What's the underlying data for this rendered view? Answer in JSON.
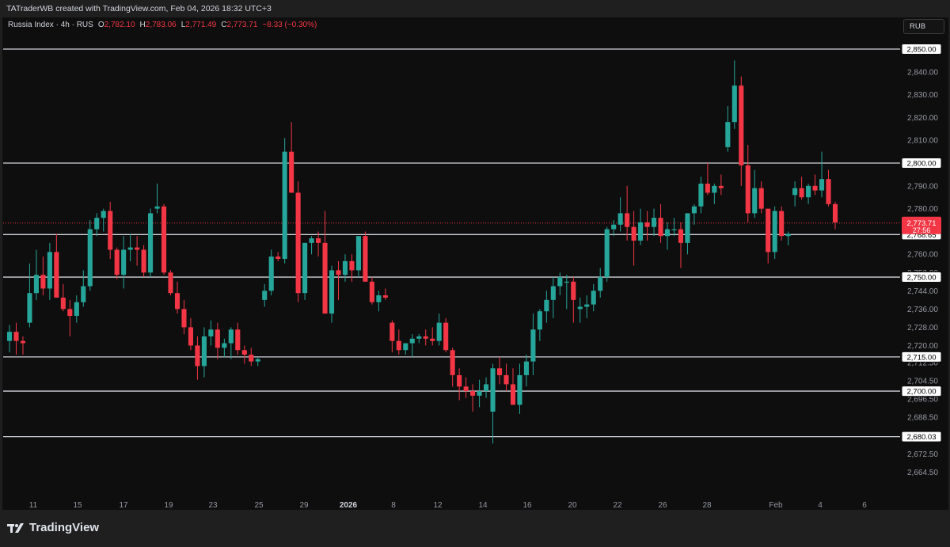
{
  "credit": "TATraderWB created with TradingView.com, Feb 04, 2026 18:32 UTC+3",
  "legend": {
    "symbol": "Russia Index · 4h · RUS",
    "o_label": "O",
    "o_value": "2,782.10",
    "h_label": "H",
    "h_value": "2,783.06",
    "l_label": "L",
    "l_value": "2,771.49",
    "c_label": "C",
    "c_value": "2,773.71",
    "change": "−8.33 (−0.30%)"
  },
  "currency": "RUB",
  "brand": "TradingView",
  "colors": {
    "up": "#26a69a",
    "down": "#f23645",
    "grid_line": "#d1d4dc",
    "background": "#0e0e0e"
  },
  "chart_data": {
    "type": "candlestick",
    "timeframe": "4h",
    "y_axis": {
      "ticks": [
        "2,840.00",
        "2,830.00",
        "2,820.00",
        "2,810.00",
        "2,790.00",
        "2,780.00",
        "2,760.00",
        "2,752.00",
        "2,744.00",
        "2,736.00",
        "2,728.00",
        "2,720.00",
        "2,712.50",
        "2,704.50",
        "2,696.50",
        "2,688.50",
        "2,672.50",
        "2,664.50"
      ],
      "tick_values": [
        2840,
        2830,
        2820,
        2810,
        2790,
        2780,
        2760,
        2752,
        2744,
        2736,
        2728,
        2720,
        2712.5,
        2704.5,
        2696.5,
        2688.5,
        2672.5,
        2664.5
      ]
    },
    "x_axis": {
      "labels": [
        "11",
        "15",
        "17",
        "19",
        "23",
        "25",
        "29",
        "2026",
        "8",
        "12",
        "14",
        "16",
        "20",
        "22",
        "26",
        "28",
        "Feb",
        "4",
        "6"
      ]
    },
    "horizontal_levels": [
      {
        "label": "2,850.00",
        "value": 2850
      },
      {
        "label": "2,800.00",
        "value": 2800
      },
      {
        "label": "2,768.65",
        "value": 2768.65
      },
      {
        "label": "2,750.00",
        "value": 2750
      },
      {
        "label": "2,715.00",
        "value": 2715
      },
      {
        "label": "2,700.00",
        "value": 2700
      },
      {
        "label": "2,680.03",
        "value": 2680.03
      }
    ],
    "last_price": {
      "label": "2,773.71",
      "countdown": "27:56",
      "value": 2773.71
    },
    "candles": [
      [
        2722,
        2729,
        2717,
        2726
      ],
      [
        2726,
        2730,
        2716,
        2722
      ],
      [
        2722,
        2724,
        2716,
        2721
      ],
      [
        2730,
        2756,
        2728,
        2743
      ],
      [
        2743,
        2762,
        2740,
        2751
      ],
      [
        2751,
        2759,
        2742,
        2745
      ],
      [
        2745,
        2765,
        2740,
        2761
      ],
      [
        2761,
        2769,
        2742,
        2741
      ],
      [
        2741,
        2747,
        2735,
        2736
      ],
      [
        2736,
        2740,
        2724,
        2733
      ],
      [
        2733,
        2742,
        2730,
        2739
      ],
      [
        2739,
        2753,
        2737,
        2746
      ],
      [
        2746,
        2775,
        2744,
        2771
      ],
      [
        2771,
        2778,
        2768,
        2776
      ],
      [
        2776,
        2780,
        2770,
        2779
      ],
      [
        2779,
        2783,
        2758,
        2762
      ],
      [
        2762,
        2763,
        2749,
        2751
      ],
      [
        2751,
        2768,
        2745,
        2762
      ],
      [
        2762,
        2769,
        2757,
        2763
      ],
      [
        2763,
        2768,
        2755,
        2762
      ],
      [
        2762,
        2764,
        2750,
        2752
      ],
      [
        2752,
        2780,
        2750,
        2778
      ],
      [
        2780,
        2791,
        2778,
        2781
      ],
      [
        2781,
        2782,
        2751,
        2752
      ],
      [
        2752,
        2753,
        2742,
        2743
      ],
      [
        2743,
        2748,
        2734,
        2736
      ],
      [
        2736,
        2740,
        2725,
        2728
      ],
      [
        2728,
        2732,
        2718,
        2720
      ],
      [
        2720,
        2724,
        2705,
        2711
      ],
      [
        2711,
        2728,
        2706,
        2724
      ],
      [
        2724,
        2731,
        2720,
        2727
      ],
      [
        2727,
        2730,
        2714,
        2719
      ],
      [
        2719,
        2723,
        2715,
        2721
      ],
      [
        2721,
        2728,
        2714,
        2727
      ],
      [
        2727,
        2730,
        2716,
        2718
      ],
      [
        2718,
        2720,
        2712,
        2716
      ],
      [
        2716,
        2719,
        2711,
        2713
      ],
      [
        2713,
        2715,
        2711,
        2714
      ],
      [
        2740,
        2747,
        2737,
        2744
      ],
      [
        2744,
        2762,
        2742,
        2759
      ],
      [
        2759,
        2761,
        2757,
        2758
      ],
      [
        2758,
        2811,
        2756,
        2805
      ],
      [
        2805,
        2818,
        2788,
        2787
      ],
      [
        2787,
        2792,
        2739,
        2743
      ],
      [
        2743,
        2765,
        2740,
        2765
      ],
      [
        2765,
        2768,
        2760,
        2767
      ],
      [
        2767,
        2770,
        2759,
        2765
      ],
      [
        2765,
        2779,
        2735,
        2734
      ],
      [
        2734,
        2755,
        2730,
        2753
      ],
      [
        2753,
        2757,
        2740,
        2751
      ],
      [
        2751,
        2760,
        2748,
        2757
      ],
      [
        2757,
        2760,
        2748,
        2753
      ],
      [
        2753,
        2768,
        2750,
        2768
      ],
      [
        2768,
        2770,
        2748,
        2748
      ],
      [
        2748,
        2750,
        2738,
        2739
      ],
      [
        2739,
        2744,
        2735,
        2742
      ],
      [
        2742,
        2745,
        2740,
        2741
      ],
      [
        2730,
        2731,
        2717,
        2722
      ],
      [
        2722,
        2727,
        2716,
        2718
      ],
      [
        2718,
        2721,
        2716,
        2721
      ],
      [
        2721,
        2725,
        2715,
        2723
      ],
      [
        2723,
        2725,
        2721,
        2724
      ],
      [
        2724,
        2727,
        2720,
        2723
      ],
      [
        2723,
        2728,
        2720,
        2722
      ],
      [
        2722,
        2734,
        2720,
        2730
      ],
      [
        2730,
        2732,
        2717,
        2718
      ],
      [
        2718,
        2719,
        2702,
        2707
      ],
      [
        2707,
        2710,
        2696,
        2702
      ],
      [
        2702,
        2706,
        2697,
        2700
      ],
      [
        2700,
        2703,
        2691,
        2698
      ],
      [
        2698,
        2705,
        2693,
        2700
      ],
      [
        2700,
        2706,
        2697,
        2703
      ],
      [
        2691,
        2712,
        2677,
        2710
      ],
      [
        2710,
        2715,
        2703,
        2707
      ],
      [
        2707,
        2712,
        2700,
        2703
      ],
      [
        2703,
        2710,
        2694,
        2694
      ],
      [
        2694,
        2712,
        2690,
        2707
      ],
      [
        2707,
        2716,
        2702,
        2713
      ],
      [
        2713,
        2734,
        2707,
        2727
      ],
      [
        2727,
        2736,
        2722,
        2735
      ],
      [
        2735,
        2744,
        2730,
        2740
      ],
      [
        2740,
        2750,
        2732,
        2746
      ],
      [
        2746,
        2752,
        2742,
        2750
      ],
      [
        2748,
        2751,
        2736,
        2748
      ],
      [
        2748,
        2750,
        2730,
        2740
      ],
      [
        2736,
        2741,
        2730,
        2737
      ],
      [
        2737,
        2742,
        2732,
        2738
      ],
      [
        2738,
        2747,
        2735,
        2744
      ],
      [
        2744,
        2754,
        2741,
        2750
      ],
      [
        2750,
        2772,
        2748,
        2771
      ],
      [
        2771,
        2775,
        2768,
        2773
      ],
      [
        2773,
        2785,
        2770,
        2778
      ],
      [
        2778,
        2790,
        2766,
        2772
      ],
      [
        2772,
        2779,
        2755,
        2766
      ],
      [
        2766,
        2780,
        2764,
        2774
      ],
      [
        2774,
        2779,
        2766,
        2772
      ],
      [
        2772,
        2780,
        2768,
        2776
      ],
      [
        2776,
        2782,
        2765,
        2768
      ],
      [
        2768,
        2774,
        2762,
        2771
      ],
      [
        2771,
        2776,
        2768,
        2771
      ],
      [
        2771,
        2774,
        2754,
        2765
      ],
      [
        2765,
        2774,
        2760,
        2778
      ],
      [
        2778,
        2782,
        2773,
        2781
      ],
      [
        2781,
        2794,
        2778,
        2791
      ],
      [
        2791,
        2800,
        2786,
        2787
      ],
      [
        2787,
        2791,
        2782,
        2790
      ],
      [
        2790,
        2795,
        2786,
        2789
      ],
      [
        2807,
        2825,
        2805,
        2818
      ],
      [
        2818,
        2845,
        2815,
        2834
      ],
      [
        2834,
        2838,
        2790,
        2799
      ],
      [
        2799,
        2808,
        2774,
        2778
      ],
      [
        2778,
        2797,
        2776,
        2789
      ],
      [
        2789,
        2792,
        2778,
        2780
      ],
      [
        2780,
        2779,
        2756,
        2761
      ],
      [
        2761,
        2781,
        2758,
        2779
      ],
      [
        2779,
        2781,
        2766,
        2768
      ],
      [
        2768,
        2770,
        2764,
        2769
      ],
      [
        2786,
        2792,
        2781,
        2789
      ],
      [
        2789,
        2794,
        2784,
        2785
      ],
      [
        2785,
        2791,
        2782,
        2790
      ],
      [
        2790,
        2795,
        2786,
        2788
      ],
      [
        2788,
        2805,
        2785,
        2793
      ],
      [
        2793,
        2797,
        2781,
        2782
      ],
      [
        2782,
        2783,
        2771,
        2774
      ]
    ]
  }
}
